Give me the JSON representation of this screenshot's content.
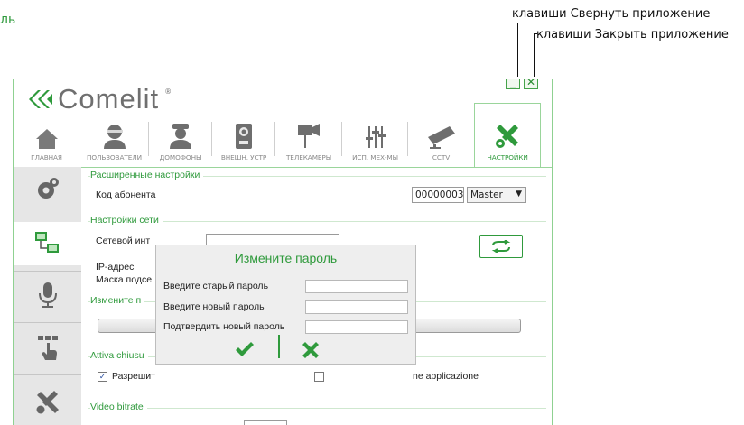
{
  "page_fragment": "ль",
  "callouts": {
    "minimize": "клавиши Свернуть приложение",
    "close": "клавиши Закрыть приложение"
  },
  "app": {
    "logo": "Comelit",
    "logo_mark": "®",
    "window_buttons": {
      "minimize": "_",
      "close": "✕"
    }
  },
  "tabs": [
    {
      "label": "ГЛАВНАЯ",
      "icon": "home-icon"
    },
    {
      "label": "ПОЛЬЗОВАТЕЛИ",
      "icon": "user-icon"
    },
    {
      "label": "ДОМОФОНЫ",
      "icon": "concierge-icon"
    },
    {
      "label": "ВНЕШН. УСТР",
      "icon": "entrance-panel-icon"
    },
    {
      "label": "ТЕЛЕКАМЕРЫ",
      "icon": "camera-icon"
    },
    {
      "label": "ИСП. МЕХ-МЫ",
      "icon": "actuator-icon"
    },
    {
      "label": "CCTV",
      "icon": "cctv-icon"
    },
    {
      "label": "НАСТРОЙКИ",
      "icon": "settings-tools-icon",
      "active": true
    }
  ],
  "sidebar": [
    {
      "icon": "gears-icon"
    },
    {
      "icon": "network-icon",
      "active": true
    },
    {
      "icon": "microphone-icon"
    },
    {
      "icon": "touch-icon"
    },
    {
      "icon": "tools-icon"
    }
  ],
  "settings": {
    "advanced": {
      "title": "Расширенные настройки",
      "subscriber_label": "Код абонента",
      "subscriber_code": "00000003",
      "role": "Master"
    },
    "network": {
      "title": "Настройки сети",
      "interface_label": "Сетевой инт",
      "ip_label": "IP-адрес",
      "mask_label": "Маска подсе"
    },
    "password": {
      "title": "Измените п"
    },
    "autoclose": {
      "title": "Attiva chiusu",
      "allow_label": "Разрешит",
      "allow_checked": true,
      "right_text": "ne applicazione"
    },
    "video": {
      "title": "Video bitrate"
    }
  },
  "dialog": {
    "title": "Измените пароль",
    "old_password_label": "Введите старый пароль",
    "new_password_label": "Введите новый пароль",
    "confirm_password_label": "Подтвердить новый пароль",
    "old_password_value": "",
    "new_password_value": "",
    "confirm_password_value": ""
  },
  "colors": {
    "accent": "#2f9a3c",
    "border": "#8fd191",
    "sidebar_bg": "#e6e6e6",
    "dialog_bg": "#eeeeee"
  }
}
